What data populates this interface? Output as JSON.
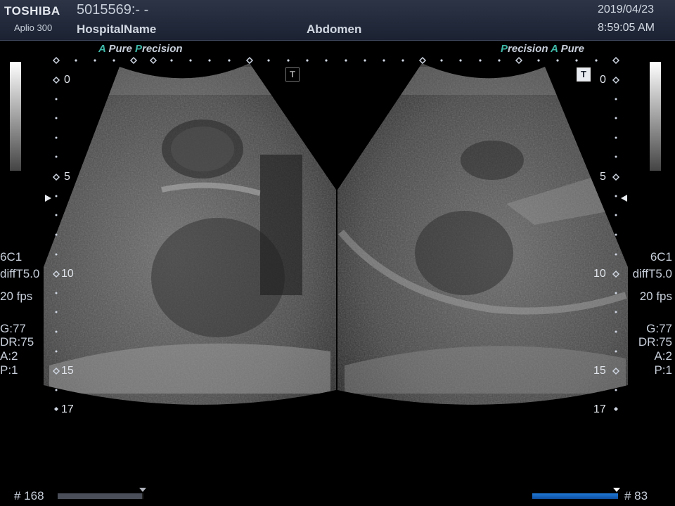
{
  "header": {
    "brand": "TOSHIBA",
    "model": "Aplio 300",
    "patient_id": "5015569:- -",
    "hospital": "HospitalName",
    "exam": "Abdomen",
    "date": "2019/04/23",
    "time": "8:59:05 AM"
  },
  "left_panel": {
    "mode_a": "A",
    "mode_pure": "Pure",
    "mode_p": "P",
    "mode_precision": "recision",
    "probe": "6C1",
    "harmonic": "diffT5.0",
    "fps": "20 fps",
    "gain": "G:77",
    "dynamic_range": "DR:75",
    "a_value": "A:2",
    "p_value": "P:1",
    "frame": "# 168",
    "progress": 0.98
  },
  "right_panel": {
    "mode_p": "P",
    "mode_precision": "recision",
    "mode_a": "A",
    "mode_pure": "Pure",
    "probe": "6C1",
    "harmonic": "diffT5.0",
    "fps": "20 fps",
    "gain": "G:77",
    "dynamic_range": "DR:75",
    "a_value": "A:2",
    "p_value": "P:1",
    "frame": "# 83",
    "progress": 1.0
  },
  "depth_ticks": [
    "0",
    "5",
    "10",
    "15",
    "17"
  ],
  "transducer_icon": "T",
  "colors": {
    "progress_left": "#4a4e58",
    "progress_right": "#1f7ad8",
    "accent": "#3fb8a8"
  }
}
